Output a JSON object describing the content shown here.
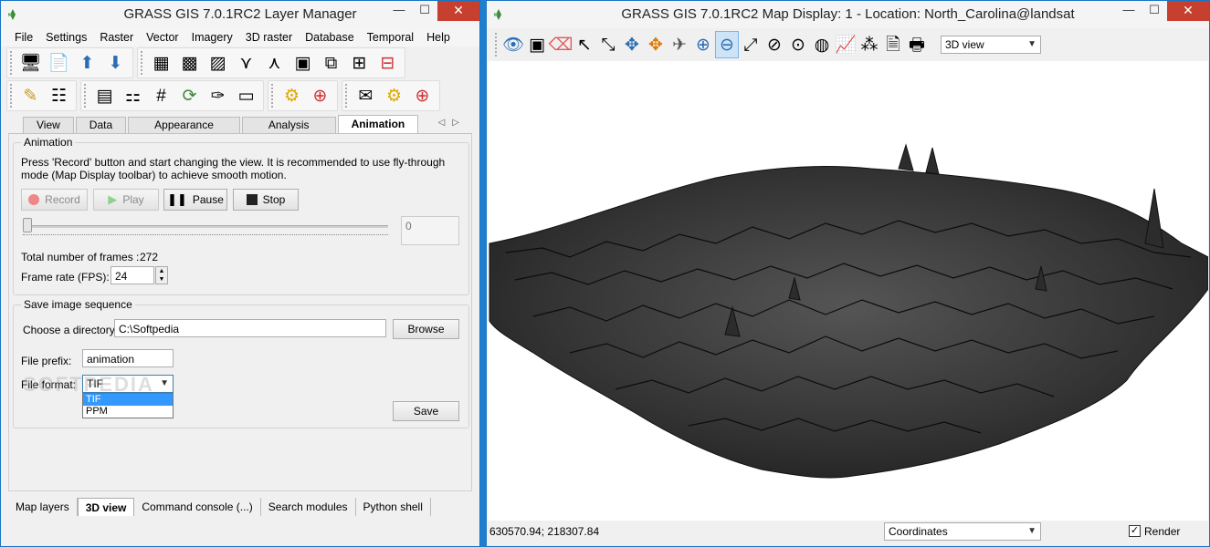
{
  "layer_manager": {
    "title": "GRASS GIS 7.0.1RC2 Layer Manager",
    "controls": {
      "minimize": "—",
      "maximize": "☐",
      "close": "✕"
    },
    "menu": [
      "File",
      "Settings",
      "Raster",
      "Vector",
      "Imagery",
      "3D raster",
      "Database",
      "Temporal",
      "Help"
    ],
    "tabs": [
      "View",
      "Data",
      "Appearance",
      "Analysis",
      "Animation"
    ],
    "active_tab": "Animation",
    "animation": {
      "group_title": "Animation",
      "description": "Press 'Record' button and start changing the view. It is recommended to use fly-through mode (Map Display toolbar) to achieve smooth motion.",
      "record_label": "Record",
      "play_label": "Play",
      "pause_label": "Pause",
      "stop_label": "Stop",
      "slider_value": "0",
      "slider_position": 0,
      "total_frames_label": "Total number of frames :",
      "total_frames_value": "272",
      "frame_rate_label": "Frame rate (FPS):",
      "frame_rate_value": "24"
    },
    "save": {
      "group_title": "Save image sequence",
      "directory_label": "Choose a directory:",
      "directory_value": "C:\\Softpedia",
      "browse_label": "Browse",
      "prefix_label": "File prefix:",
      "prefix_value": "animation",
      "format_label": "File format:",
      "format_value": "TIF",
      "format_options": [
        "TIF",
        "PPM"
      ],
      "save_label": "Save"
    },
    "bottom_tabs": [
      "Map layers",
      "3D view",
      "Command console (...)",
      "Search modules",
      "Python shell"
    ],
    "active_bottom_tab": "3D view"
  },
  "map_display": {
    "title": "GRASS GIS 7.0.1RC2 Map Display: 1  - Location: North_Carolina@landsat",
    "view_mode": "3D view",
    "coordinates": "630570.94; 218307.84",
    "status_mode": "Coordinates",
    "render_label": "Render",
    "render_checked": true
  },
  "watermark": "SOFTPEDIA",
  "colors": {
    "accent": "#1e7fd0",
    "close_button": "#c7402f",
    "tab_underline": "#aacfb8",
    "terrain": "#3a3a3a"
  }
}
